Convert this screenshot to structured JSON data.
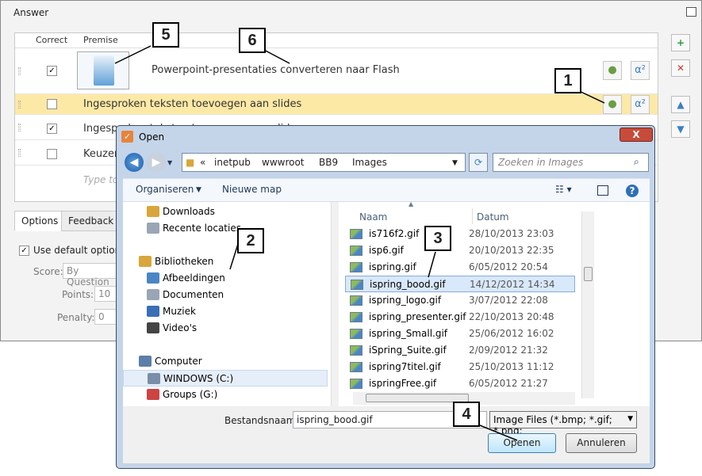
{
  "answer": {
    "title": "Answer",
    "headers": {
      "correct": "Correct",
      "premise": "Premise"
    },
    "rows": [
      {
        "checked": true,
        "text": "Powerpoint-presentaties converteren naar Flash"
      },
      {
        "checked": false,
        "text": "Ingesproken teksten toevoegen aan slides"
      },
      {
        "checked": true,
        "text": "Ingesproken teksten toevoegen aan slides"
      },
      {
        "checked": false,
        "text": "Keuzen"
      }
    ],
    "type_placeholder": "Type to",
    "tabs": [
      "Options",
      "Feedback and"
    ],
    "options": {
      "use_default": "Use default options",
      "score_label": "Score:",
      "score_value": "By Question",
      "points_label": "Points:",
      "points_value": "10",
      "penalty_label": "Penalty:",
      "penalty_value": "0"
    },
    "check_mark": "✓",
    "alpha_symbol": "α²"
  },
  "dialog": {
    "title": "Open",
    "close": "X",
    "path": [
      "«",
      "inetpub",
      "wwwroot",
      "BB9",
      "Images"
    ],
    "search_placeholder": "Zoeken in Images",
    "toolbar": {
      "organize": "Organiseren",
      "new_folder": "Nieuwe map"
    },
    "nav": [
      {
        "label": "Downloads",
        "color": "#d9a63b"
      },
      {
        "label": "Recente locaties",
        "color": "#9aa6b5"
      },
      {
        "label": "Bibliotheken",
        "color": "#d9a63b"
      },
      {
        "label": "Afbeeldingen",
        "color": "#4a86c6"
      },
      {
        "label": "Documenten",
        "color": "#9aa6b5"
      },
      {
        "label": "Muziek",
        "color": "#3a6fb5"
      },
      {
        "label": "Video's",
        "color": "#444"
      },
      {
        "label": "Computer",
        "color": "#5b7fa8"
      },
      {
        "label": "WINDOWS (C:)",
        "color": "#7a8ea8"
      },
      {
        "label": "Groups (G:)",
        "color": "#c44"
      }
    ],
    "columns": {
      "name": "Naam",
      "date": "Datum"
    },
    "files": [
      {
        "name": "is716f2.gif",
        "date": "28/10/2013 23:03"
      },
      {
        "name": "isp6.gif",
        "date": "20/10/2013 22:35"
      },
      {
        "name": "ispring.gif",
        "date": "6/05/2012 20:54"
      },
      {
        "name": "ispring_bood.gif",
        "date": "14/12/2012 14:34"
      },
      {
        "name": "ispring_logo.gif",
        "date": "3/07/2012 22:08"
      },
      {
        "name": "ispring_presenter.gif",
        "date": "22/10/2013 20:48"
      },
      {
        "name": "ispring_Small.gif",
        "date": "25/06/2012 16:02"
      },
      {
        "name": "iSpring_Suite.gif",
        "date": "2/09/2012 21:32"
      },
      {
        "name": "ispring7titel.gif",
        "date": "25/10/2013 11:12"
      },
      {
        "name": "ispringFree.gif",
        "date": "6/05/2012 21:27"
      }
    ],
    "filename_label": "Bestandsnaam:",
    "filename_value": "ispring_bood.gif",
    "filetype": "Image Files (*.bmp; *.gif; *.png;",
    "open_button": "Openen",
    "cancel_button": "Annuleren"
  },
  "callouts": [
    "1",
    "2",
    "3",
    "4",
    "5",
    "6"
  ]
}
